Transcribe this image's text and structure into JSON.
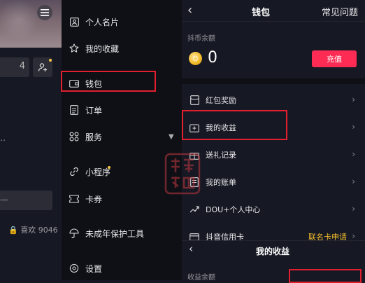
{
  "profile": {
    "edit_count_fragment": "4",
    "bio_fragment": "…",
    "search_fragment": "—",
    "likes_text": "🔒 喜欢 9046"
  },
  "drawer": {
    "items": [
      {
        "label": "个人名片",
        "icon": "id-card-icon"
      },
      {
        "label": "我的收藏",
        "icon": "star-icon"
      },
      {
        "label": "钱包",
        "icon": "wallet-icon"
      },
      {
        "label": "订单",
        "icon": "order-icon"
      },
      {
        "label": "服务",
        "icon": "grid-icon"
      },
      {
        "label": "小程序",
        "icon": "link-icon"
      },
      {
        "label": "卡券",
        "icon": "ticket-icon"
      },
      {
        "label": "未成年保护工具",
        "icon": "umbrella-icon"
      },
      {
        "label": "设置",
        "icon": "gear-icon"
      }
    ]
  },
  "wallet": {
    "title": "钱包",
    "faq": "常见问题",
    "coin_label": "抖币余额",
    "coin_balance": "0",
    "recharge": "充值",
    "rows": [
      {
        "label": "红包奖励",
        "icon": "red-packet-icon"
      },
      {
        "label": "我的收益",
        "icon": "income-icon"
      },
      {
        "label": "送礼记录",
        "icon": "gift-icon"
      },
      {
        "label": "我的账单",
        "icon": "bill-icon"
      },
      {
        "label": "DOU+个人中心",
        "icon": "trend-icon"
      },
      {
        "label": "抖音信用卡",
        "icon": "card-icon"
      }
    ],
    "card_extra": "联名卡申请"
  },
  "income": {
    "title": "我的收益",
    "balance_label": "收益余额"
  },
  "watermark": {
    "line1": "抖商",
    "line2": "公社"
  },
  "colors": {
    "accent": "#fe2c55",
    "highlight": "#e11f2f",
    "gold": "#f2bd2c",
    "background": "#161823"
  }
}
